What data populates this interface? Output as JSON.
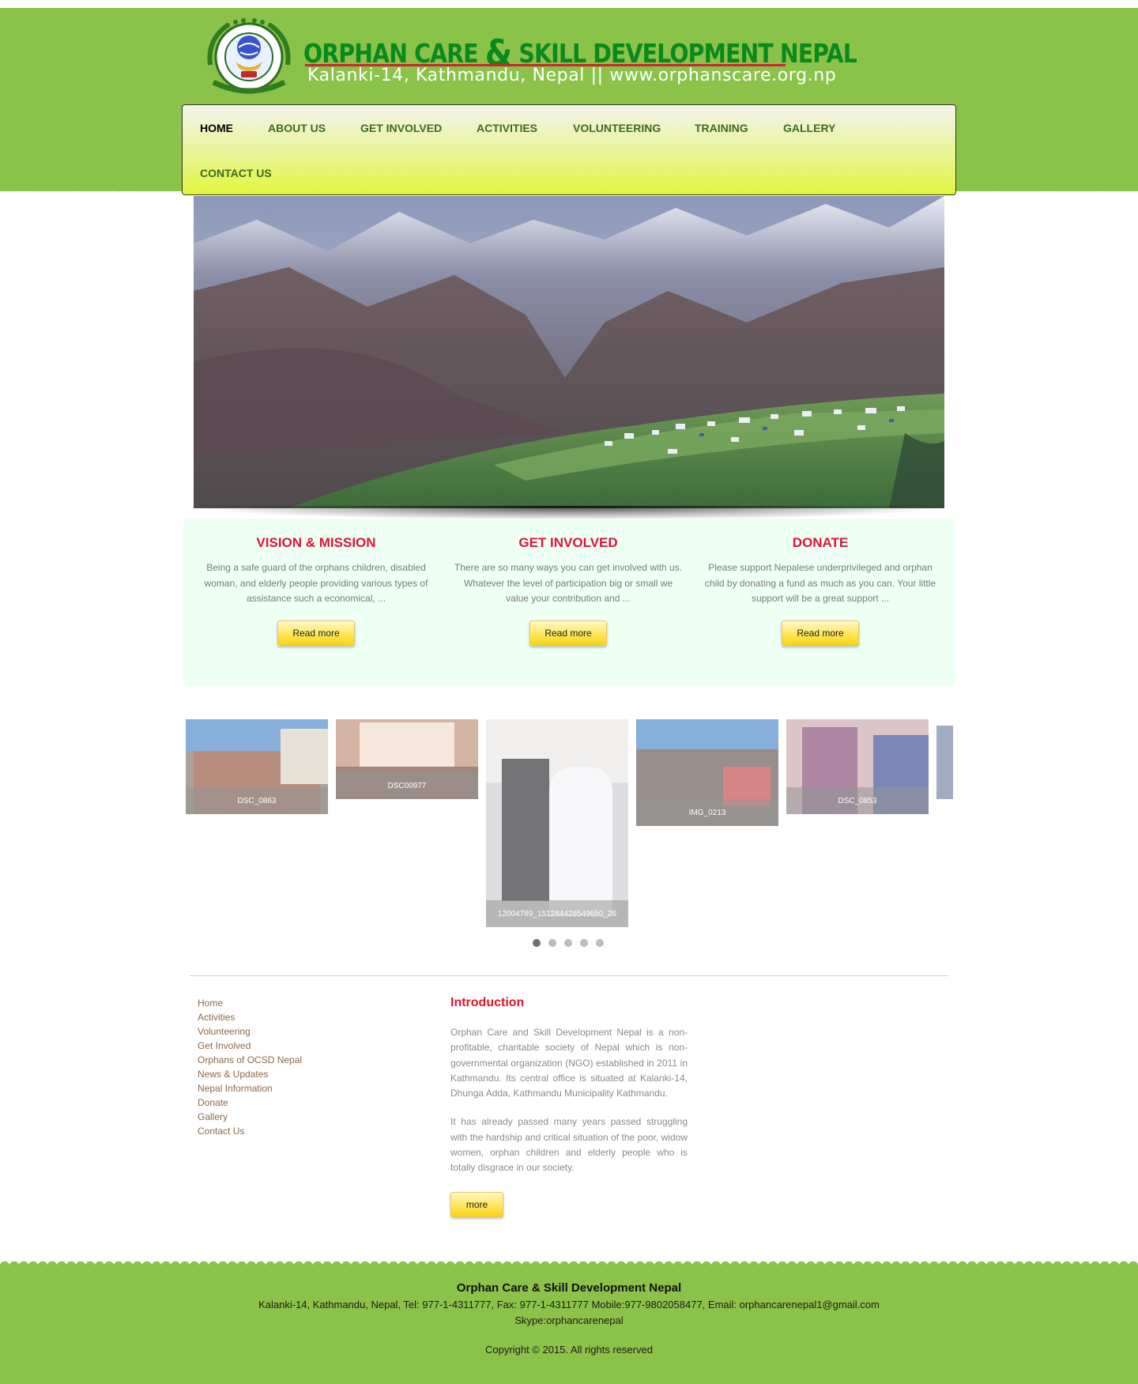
{
  "site": {
    "name": "ORPHAN CARE",
    "amp": "&",
    "name_rest": "SKILL DEVELOPMENT NEPAL",
    "tagline": "Kalanki-14, Kathmandu, Nepal || www.orphanscare.org.np",
    "brand_green": "#0a8a1c",
    "header_green": "#8bc34a",
    "accent_red": "#e0133a"
  },
  "nav": {
    "items": [
      {
        "label": "HOME",
        "active": true
      },
      {
        "label": "ABOUT US"
      },
      {
        "label": "GET INVOLVED"
      },
      {
        "label": "ACTIVITIES"
      },
      {
        "label": "VOLUNTEERING"
      },
      {
        "label": "TRAINING"
      },
      {
        "label": "GALLERY"
      },
      {
        "label": "CONTACT US"
      }
    ]
  },
  "promo": [
    {
      "title": "VISION & MISSION",
      "text": "Being a safe guard of the orphans children, disabled woman, and elderly people providing various types of assistance such a economical, ...",
      "button": "Read more"
    },
    {
      "title": "GET INVOLVED",
      "text": "There are so many ways you can get involved with us. Whatever the level of participation big or small we value your contribution and ...",
      "button": "Read more"
    },
    {
      "title": "DONATE",
      "text": "Please support Nepalese underprivileged and orphan child by donating a fund as much as you can. Your little support will be a great support ...",
      "button": "Read more"
    }
  ],
  "gallery": {
    "items": [
      {
        "caption": "DSC_0863"
      },
      {
        "caption": "DSC00977"
      },
      {
        "caption": "12004789_151284428549650_26"
      },
      {
        "caption": "IMG_0213"
      },
      {
        "caption": "DSC_0853"
      }
    ],
    "pages": 5,
    "current_page": 1
  },
  "sidebar_links": [
    "Home",
    "Activities",
    "Volunteering",
    "Get Involved",
    "Orphans of OCSD Nepal",
    "News & Updates",
    "Nepal Information",
    "Donate",
    "Gallery",
    "Contact Us"
  ],
  "intro": {
    "title": "Introduction",
    "p1": "Orphan Care and Skill Development Nepal is a non-profitable, charitable society of Nepal which is non-governmental organization (NGO) established in 2011 in Kathmandu. Its central office is situated at Kalanki-14, Dhunga Adda, Kathmandu Municipality Kathmandu.",
    "p2": "It has already passed many years passed struggling with the hardship and critical situation of the poor, widow women, orphan children and elderly people who is totally disgrace in our society.",
    "button": "more"
  },
  "footer": {
    "name": "Orphan Care & Skill Development Nepal",
    "address": "Kalanki-14, Kathmandu, Nepal, Tel: 977-1-4311777, Fax: 977-1-4311777 Mobile:977-9802058477, Email: orphancarenepal1@gmail.com",
    "skype": "Skype:orphancarenepal",
    "copyright": "Copyright © 2015. All rights reserved"
  }
}
